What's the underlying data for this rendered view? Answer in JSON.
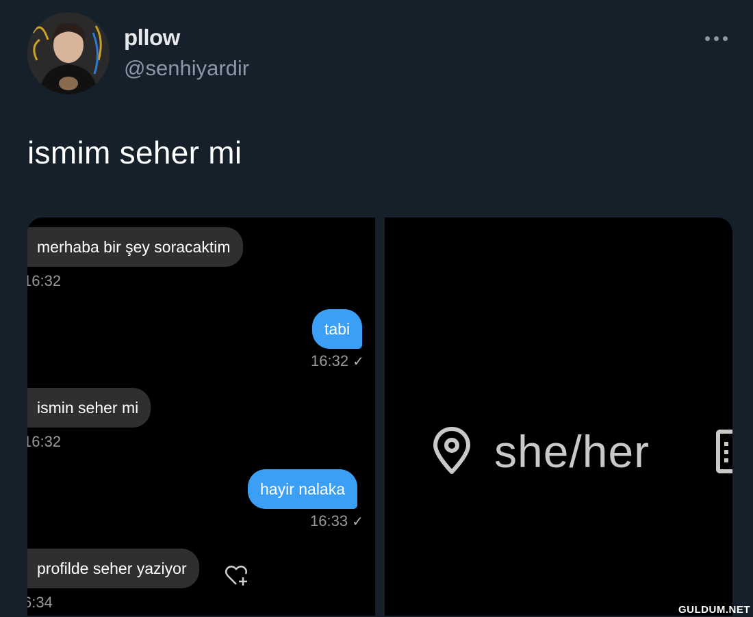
{
  "tweet": {
    "display_name": "pllow",
    "handle": "@senhiyardir",
    "text": "ismim seher mi",
    "more_icon": "more-horizontal-icon"
  },
  "chat": {
    "messages": [
      {
        "side": "in",
        "text": "merhaba bir şey soracaktim",
        "time": "16:32"
      },
      {
        "side": "out",
        "text": "tabi",
        "time": "16:32",
        "status": "✓"
      },
      {
        "side": "in",
        "text": "ismin seher mi",
        "time": "16:32"
      },
      {
        "side": "out",
        "text": "hayir nalaka",
        "time": "16:33",
        "status": "✓"
      },
      {
        "side": "in",
        "text": "profilde seher yaziyor",
        "time": "6:34",
        "reaction_icon": "heart-add-icon"
      }
    ],
    "time_prefix_partial": [
      "16:32",
      "16:32",
      "6:34"
    ],
    "colors": {
      "incoming": "#2f2f2f",
      "outgoing": "#3a9ff5"
    }
  },
  "profile_shot": {
    "location_icon": "location-pin-icon",
    "pronouns": "she/her"
  },
  "watermark": "GULDUM.NET",
  "colors": {
    "background": "#15202b",
    "handle": "#8b98a5"
  }
}
